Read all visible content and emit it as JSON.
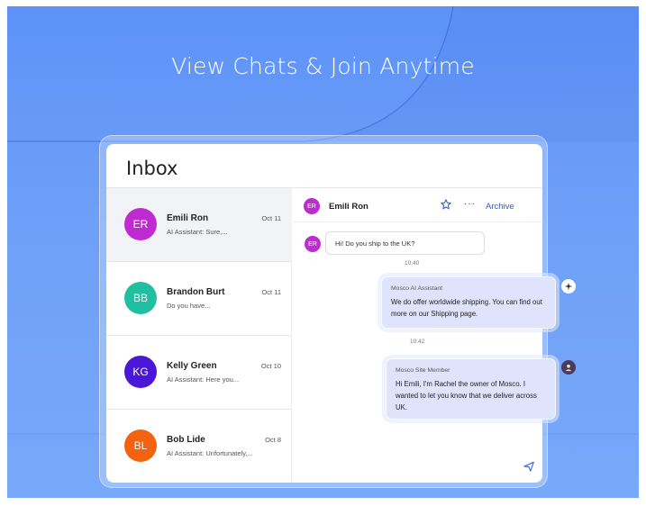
{
  "headline": "View Chats & Join Anytime",
  "inbox_title": "Inbox",
  "conversations": [
    {
      "initials": "ER",
      "name": "Emili Ron",
      "preview": "AI Assistant: Sure,...",
      "date": "Oct 11",
      "avatar_color": "#c02bd1",
      "active": true
    },
    {
      "initials": "BB",
      "name": "Brandon Burt",
      "preview": "Do you have...",
      "date": "Oct 11",
      "avatar_color": "#1fbfa0",
      "active": false
    },
    {
      "initials": "KG",
      "name": "Kelly Green",
      "preview": "AI Assistant: Here you...",
      "date": "Oct 10",
      "avatar_color": "#4a17d8",
      "active": false
    },
    {
      "initials": "BL",
      "name": "Bob Lide",
      "preview": "AI Assistant: Unfortunately,...",
      "date": "Oct 8",
      "avatar_color": "#f2620f",
      "active": false
    }
  ],
  "chat": {
    "contact_initials": "ER",
    "contact_name": "Emili Ron",
    "archive_label": "Archive",
    "more_label": "···",
    "incoming_message": "Hi! Do you ship to the UK?",
    "time_1": "10:40",
    "ai_label": "Mosco AI Assistant",
    "ai_message": "We do offer worldwide shipping. You can find out more on our Shipping page.",
    "time_2": "10:42",
    "owner_label": "Mosco Site Member",
    "owner_message": "Hi Emili, I'm Rachel the owner of Mosco. I wanted to let you know that we deliver across UK."
  },
  "colors": {
    "hero_background": "#6a9cf8",
    "accent": "#2e5fd6",
    "outgoing_bubble": "#dfe4fc"
  }
}
